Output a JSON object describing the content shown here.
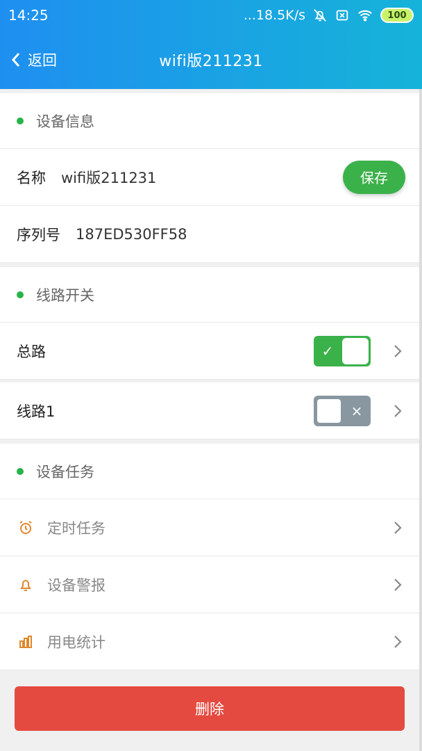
{
  "status_bar": {
    "time": "14:25",
    "network_speed": "...18.5K/s",
    "battery": "100",
    "icons": [
      "mute-icon",
      "sim-off-icon",
      "wifi-icon",
      "battery-icon"
    ]
  },
  "navbar": {
    "back_label": "返回",
    "title": "wifi版211231"
  },
  "device_info": {
    "section_title": "设备信息",
    "name_label": "名称",
    "name_value": "wifi版211231",
    "save_label": "保存",
    "serial_label": "序列号",
    "serial_value": "187ED530FF58"
  },
  "circuit_switch": {
    "section_title": "线路开关",
    "rows": [
      {
        "label": "总路",
        "on": true
      },
      {
        "label": "线路1",
        "on": false
      }
    ]
  },
  "device_tasks": {
    "section_title": "设备任务",
    "items": [
      {
        "label": "定时任务",
        "icon": "alarm-clock-icon"
      },
      {
        "label": "设备警报",
        "icon": "bell-icon"
      },
      {
        "label": "用电统计",
        "icon": "bar-chart-icon"
      }
    ]
  },
  "actions": {
    "delete_label": "删除"
  },
  "colors": {
    "header_gradient_start": "#1e8ff0",
    "header_gradient_end": "#16b3d9",
    "accent_green": "#3bb14a",
    "danger_red": "#e44a3f",
    "icon_orange": "#e0872b"
  }
}
